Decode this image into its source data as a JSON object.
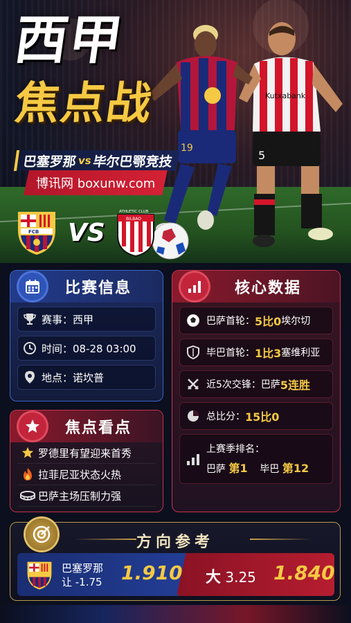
{
  "hero": {
    "title_line1": "西甲",
    "title_line2": "焦点战",
    "home_team": "巴塞罗那",
    "vs": "vs",
    "away_team": "毕尔巴鄂竞技",
    "site": "博讯网 boxunw.com",
    "home_crest_text": "FCB",
    "away_crest_text_top": "ATHLETIC CLUB",
    "away_crest_text_bottom": "BILBAO",
    "crest_vs": "VS",
    "player1_number": "19",
    "player2_number": "5",
    "player2_shirt_text": "Kutxabank"
  },
  "match_info": {
    "title": "比赛信息",
    "rows": [
      {
        "icon": "trophy-icon",
        "label": "赛事：西甲"
      },
      {
        "icon": "clock-icon",
        "label": "时间：08-28 03:00"
      },
      {
        "icon": "location-pin-icon",
        "label": "地点：诺坎普"
      }
    ]
  },
  "core_data": {
    "title": "核心数据",
    "rows": [
      {
        "icon": "soccer-ball-icon",
        "prefix": "巴萨首轮：",
        "highlight": "5比0",
        "suffix": " 埃尔切"
      },
      {
        "icon": "shield-icon",
        "prefix": "毕巴首轮：",
        "highlight": "1比3",
        "suffix": " 塞维利亚"
      },
      {
        "icon": "crossed-swords-icon",
        "prefix": "近5次交锋：巴萨",
        "highlight": "5连胜",
        "suffix": ""
      },
      {
        "icon": "pie-chart-icon",
        "prefix": "总比分：",
        "highlight": "15比0",
        "suffix": ""
      }
    ],
    "ranking": {
      "label": "上赛季排名：",
      "home_prefix": "巴萨",
      "home_rank": "第1",
      "away_prefix": "毕巴",
      "away_rank": "第12"
    }
  },
  "focus": {
    "title": "焦点看点",
    "items": [
      {
        "icon": "star-icon",
        "text": "罗德里有望迎来首秀"
      },
      {
        "icon": "fire-icon",
        "text": "拉菲尼亚状态火热"
      },
      {
        "icon": "stadium-icon",
        "text": "巴萨主场压制力强"
      }
    ]
  },
  "reference": {
    "title": "方向参考",
    "home_line1": "巴塞罗那",
    "home_line2": "让 -1.75",
    "home_odds": "1.910",
    "total_label": "大",
    "total_value": "3.25",
    "total_odds": "1.840"
  },
  "colors": {
    "gold": "#f6c944",
    "barca_blue": "#1c2f7a",
    "barca_red": "#a51a2c",
    "panel_blue": "#3a66c8",
    "panel_red": "#c8334a"
  }
}
